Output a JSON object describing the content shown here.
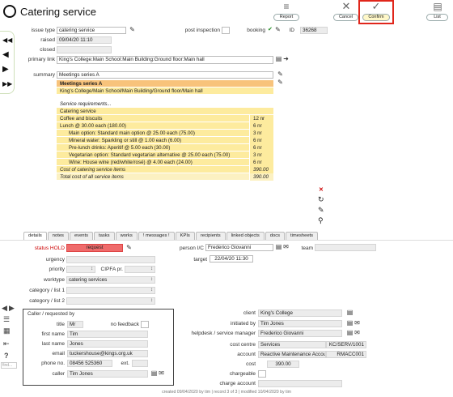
{
  "app": {
    "title": "Catering service"
  },
  "toolbar": {
    "report": "Report",
    "cancel": "Cancel",
    "confirm": "Confirm",
    "list": "List"
  },
  "nav": {
    "find": "find..."
  },
  "header": {
    "issue_type_label": "issue type",
    "issue_type": "catering service",
    "raised_label": "raised",
    "raised": "09/04/20 11:10",
    "closed_label": "closed",
    "closed": "",
    "post_inspection_label": "post inspection",
    "booking_label": "booking",
    "id_label": "ID",
    "id": "36268",
    "primary_link_label": "primary link",
    "primary_link": "King's College:Main School:Main Building:Ground floor:Main hall",
    "summary_label": "summary",
    "summary": "Meetings series A"
  },
  "meetings": {
    "title": "Meetings series A",
    "location": "King's College/Main School/Main Building/Ground floor/Main hall",
    "requirements": "Service requirements...",
    "service_header": "Catering service",
    "lines": [
      {
        "desc": "Coffee and biscuits",
        "qty": "12 nr",
        "indent": false
      },
      {
        "desc": "Lunch @ 30.00 each (180.00)",
        "qty": "6 nr",
        "indent": false
      },
      {
        "desc": "Main option: Standard main option @ 25.00 each (75.00)",
        "qty": "3 nr",
        "indent": true
      },
      {
        "desc": "Mineral water: Sparkling or still @ 1.00 each (6.00)",
        "qty": "6 nr",
        "indent": true
      },
      {
        "desc": "Pre-lunch drinks: Aperitif @ 5.00 each (30.00)",
        "qty": "6 nr",
        "indent": true
      },
      {
        "desc": "Vegetarian option: Standard vegetarian alternative @ 25.00 each (75.00)",
        "qty": "3 nr",
        "indent": true
      },
      {
        "desc": "Wine: House wine (red/white/rosé) @ 4.00 each (24.00)",
        "qty": "6 nr",
        "indent": true
      }
    ],
    "cost_label": "Cost of catering service items",
    "cost": "390.00",
    "total_label": "Total cost of all service items",
    "total": "390.00"
  },
  "tabs": [
    "details",
    "notes",
    "events",
    "tasks",
    "works",
    "! messages !",
    "KPIs",
    "recipients",
    "linked objects",
    "docs",
    "timesheets"
  ],
  "details": {
    "status_label": "status HOLD",
    "status": "request",
    "person_ic_label": "person I/C",
    "person_ic": "Frederico Giovanni",
    "team_label": "team",
    "team": "",
    "urgency_label": "urgency",
    "urgency": "",
    "target_label": "target",
    "target": "22/04/20 11:30",
    "priority_label": "priority",
    "priority": "",
    "cipfa_label": "CIPFA pr.",
    "cipfa": "",
    "worktype_label": "worktype",
    "worktype": "catering services",
    "category1_label": "category / list 1",
    "category1": "",
    "category2_label": "category / list 2",
    "category2": ""
  },
  "caller": {
    "box_title": "Caller / requested by",
    "title_label": "title",
    "title": "Mr",
    "no_feedback_label": "no feedback",
    "first_name_label": "first name",
    "first_name": "Tim",
    "last_name_label": "last name",
    "last_name": "Jones",
    "email_label": "email",
    "email": "tuckershouse@kings.org.uk",
    "phone_label": "phone no.",
    "phone": "08456 525360",
    "ext_label": "ext.",
    "ext": "",
    "caller_label": "caller",
    "caller": "Tim Jones"
  },
  "right": {
    "client_label": "client",
    "client": "King's College",
    "initiated_label": "initiated by",
    "initiated": "Tim Jones",
    "helpdesk_label": "helpdesk / service manager",
    "helpdesk": "Frederico Giovanni",
    "cost_centre_label": "cost centre",
    "cost_centre": "Services",
    "cost_centre_code": "KC/SERV/1001",
    "account_label": "account",
    "account": "Reactive Maintenance Account",
    "account_code": "RMACC001",
    "cost_label": "cost",
    "cost": "390.00",
    "chargeable_label": "chargeable",
    "charge_account_label": "charge account",
    "charge_account": ""
  },
  "footer": "created 09/04/2020 by tim | record 3 of 3 | modified 10/04/2020 by tim"
}
